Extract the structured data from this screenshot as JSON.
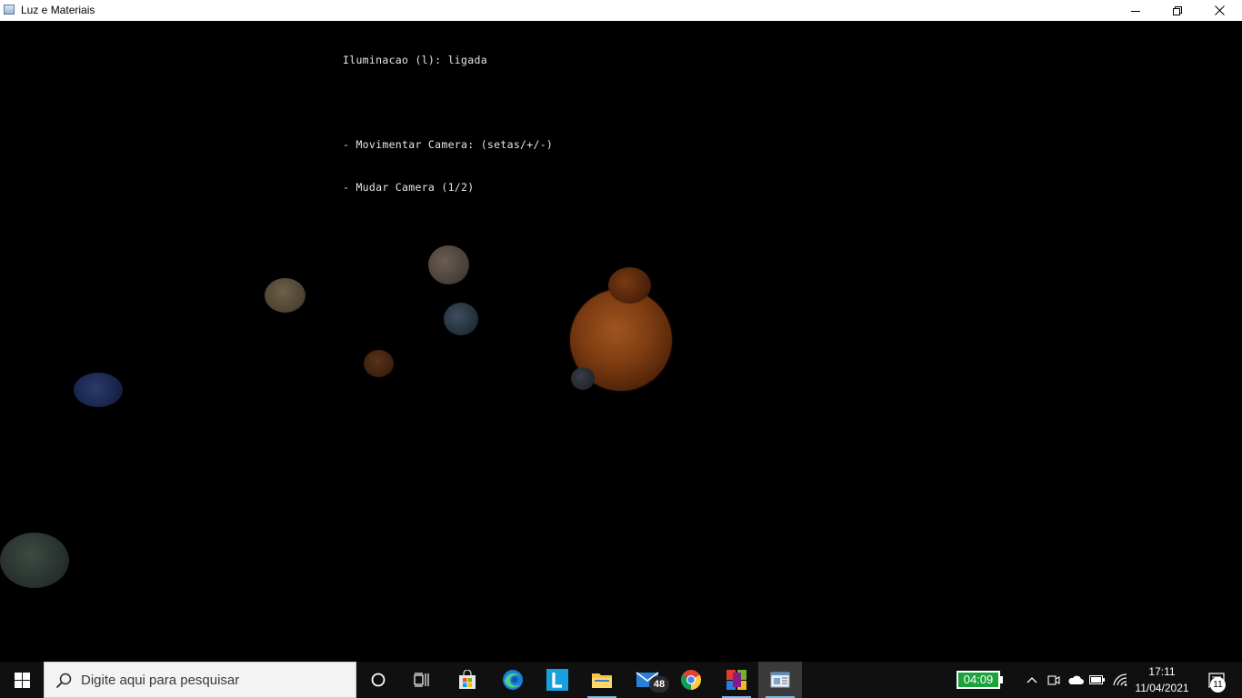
{
  "window": {
    "title": "Luz e Materiais"
  },
  "hud": {
    "lighting": "Iluminacao (l): ligada",
    "move_camera": "- Movimentar Camera: (setas/+/-)",
    "change_camera": "- Mudar Camera (1/2)"
  },
  "taskbar": {
    "search_placeholder": "Digite aqui para pesquisar",
    "mail_badge": "48",
    "timer": "04:09",
    "time": "17:11",
    "date": "11/04/2021",
    "notifications": "11"
  },
  "colors": {
    "timer_green": "#1aa33a",
    "taskbar_bg": "#101010",
    "active_underline": "#76b9ed"
  }
}
